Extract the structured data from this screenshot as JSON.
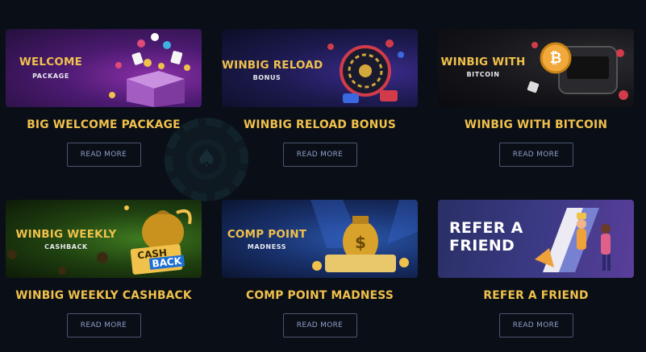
{
  "read_more_label": "READ MORE",
  "promos": [
    {
      "banner_title": "WELCOME",
      "banner_sub": "PACKAGE",
      "title": "BIG WELCOME PACKAGE"
    },
    {
      "banner_title": "WINBIG RELOAD",
      "banner_sub": "BONUS",
      "title": "WINBIG RELOAD BONUS"
    },
    {
      "banner_title": "WINBIG WITH",
      "banner_sub": "BITCOIN",
      "title": "WINBIG WITH BITCOIN"
    },
    {
      "banner_title": "WINBIG WEEKLY",
      "banner_sub": "CASHBACK",
      "title": "WINBIG WEEKLY CASHBACK",
      "badge_line1": "CASH",
      "badge_line2": "BACK"
    },
    {
      "banner_title": "COMP POINT",
      "banner_sub": "MADNESS",
      "title": "COMP POINT MADNESS"
    },
    {
      "banner_title_line1": "REFER A",
      "banner_title_line2": "FRIEND",
      "title": "REFER A FRIEND"
    }
  ],
  "colors": {
    "background": "#0a0e17",
    "gold": "#f0c14b",
    "button_border": "#4a5670",
    "button_text": "#8ea0c8"
  }
}
